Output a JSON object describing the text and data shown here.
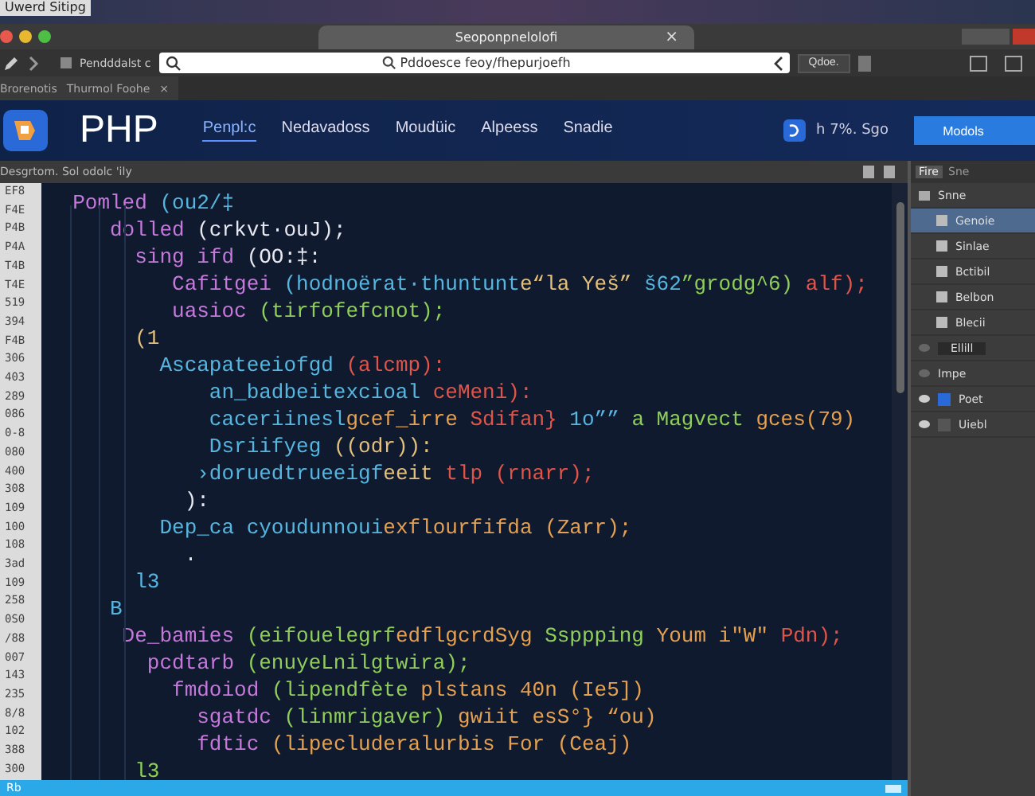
{
  "top_strip": {
    "label": "Uwerd Sitipg"
  },
  "window": {
    "tab_title": "Seoponpnelolofi",
    "close": "×"
  },
  "toolbar": {
    "label": "Pendddalst c",
    "address": "Pddoesce feoy/fhepurjoefh",
    "button": "Qdoe."
  },
  "bookmarks": {
    "items": [
      "Brorenotis",
      "Thurmol Foohe"
    ],
    "close": "×"
  },
  "site": {
    "logo": "PHP",
    "nav": [
      {
        "label": "Penpl:c",
        "selected": true
      },
      {
        "label": "Nedavadoss",
        "selected": false
      },
      {
        "label": "Moudüic",
        "selected": false
      },
      {
        "label": "Alpeess",
        "selected": false
      },
      {
        "label": "Snadie",
        "selected": false
      }
    ],
    "stat": "h 7%. Sgo",
    "button": "Modols"
  },
  "editor": {
    "title": "Desgrtom. Sol odolc 'ily",
    "gutter": [
      "EF8",
      "F4E",
      "P4B",
      "P4A",
      "T4B",
      "T4E",
      "519",
      "394",
      "F4B",
      "306",
      "403",
      "289",
      "086",
      "0-8",
      "080",
      "400",
      "308",
      "109",
      "100",
      "108",
      "3ad",
      "109",
      "258",
      "0S0",
      "/88",
      "007",
      "143",
      "235",
      "8/8",
      "102",
      "388",
      "300"
    ],
    "lines": [
      [
        {
          "text": "  Pomled ",
          "color": "#c678dd"
        },
        {
          "text": "(ou2/‡",
          "color": "#56b6e0"
        }
      ],
      [
        {
          "text": "     dolled ",
          "color": "#c678dd"
        },
        {
          "text": "(crkvt·ouJ);",
          "color": "#e8e8f0"
        }
      ],
      [
        {
          "text": "       sing ifd ",
          "color": "#c678dd"
        },
        {
          "text": "(OO:‡:",
          "color": "#e8e8f0"
        }
      ],
      [
        {
          "text": "          Cafitgei ",
          "color": "#c678dd"
        },
        {
          "text": "(hodnoërat·thuntunt",
          "color": "#56b6e0"
        },
        {
          "text": "e“la Yeš” ",
          "color": "#e5c07b"
        },
        {
          "text": "š62",
          "color": "#56b6e0"
        },
        {
          "text": "”grodg^6) ",
          "color": "#8fce5a"
        },
        {
          "text": "alf);",
          "color": "#e0554a"
        }
      ],
      [
        {
          "text": "          uasioc ",
          "color": "#c678dd"
        },
        {
          "text": "(tirfofefcnot);",
          "color": "#8fce5a"
        }
      ],
      [
        {
          "text": "       (1",
          "color": "#e5c07b"
        }
      ],
      [
        {
          "text": "         Ascapateeiofgd ",
          "color": "#56b6e0"
        },
        {
          "text": "(alcmp):",
          "color": "#e0554a"
        }
      ],
      [
        {
          "text": "             an_badbeitexcioal ",
          "color": "#56b6e0"
        },
        {
          "text": "ceMeni):",
          "color": "#e0554a"
        }
      ],
      [
        {
          "text": "             caceriinesl",
          "color": "#56b6e0"
        },
        {
          "text": "gcef_irre ",
          "color": "#e5a050"
        },
        {
          "text": "Sdifan} ",
          "color": "#e0554a"
        },
        {
          "text": "1o”” ",
          "color": "#56b6e0"
        },
        {
          "text": "a Magvect ",
          "color": "#8fce5a"
        },
        {
          "text": "gces(79)",
          "color": "#e5a050"
        }
      ],
      [
        {
          "text": "             Dsriifyeg ",
          "color": "#56b6e0"
        },
        {
          "text": "((odr)):",
          "color": "#e5c07b"
        }
      ],
      [
        {
          "text": "            ›doruedtrueeigf",
          "color": "#56b6e0"
        },
        {
          "text": "eeit ",
          "color": "#e5c07b"
        },
        {
          "text": "tlp (rnarr);",
          "color": "#e0554a"
        }
      ],
      [
        {
          "text": "           ):",
          "color": "#e8e8f0"
        }
      ],
      [
        {
          "text": "         Dep_ca ",
          "color": "#56b6e0"
        },
        {
          "text": "cyoudunnoui",
          "color": "#56b6e0"
        },
        {
          "text": "exflourfi",
          "color": "#e5a050"
        },
        {
          "text": "fda (Zarr);",
          "color": "#e5a050"
        }
      ],
      [
        {
          "text": "           .",
          "color": "#e8e8f0"
        }
      ],
      [
        {
          "text": "       l3",
          "color": "#56b6e0"
        }
      ],
      [
        {
          "text": "     B",
          "color": "#56b6e0"
        }
      ],
      [
        {
          "text": "      De_bamies ",
          "color": "#c678dd"
        },
        {
          "text": "(eifouelegrf",
          "color": "#8fce5a"
        },
        {
          "text": "edflgcrdSyg ",
          "color": "#e5a050"
        },
        {
          "text": "Ssppping ",
          "color": "#8fce5a"
        },
        {
          "text": "Youm i\"W\" ",
          "color": "#e5a050"
        },
        {
          "text": "Pdn);",
          "color": "#e0554a"
        }
      ],
      [
        {
          "text": "        pcdtarb ",
          "color": "#c678dd"
        },
        {
          "text": "(enuyeLnilgtwira);",
          "color": "#8fce5a"
        }
      ],
      [
        {
          "text": "          fmdoiod ",
          "color": "#c678dd"
        },
        {
          "text": "(lipendfète ",
          "color": "#8fce5a"
        },
        {
          "text": "plstans 40n (Ie5])",
          "color": "#e5a050"
        }
      ],
      [
        {
          "text": "            sgatdc ",
          "color": "#c678dd"
        },
        {
          "text": "(linmrigaver) ",
          "color": "#8fce5a"
        },
        {
          "text": "gwiit esS°} “ou)",
          "color": "#e5a050"
        }
      ],
      [
        {
          "text": "            fdtic ",
          "color": "#c678dd"
        },
        {
          "text": "(lipecluderalurbis ",
          "color": "#e5a050"
        },
        {
          "text": "For (Ceaj)",
          "color": "#e5a050"
        }
      ],
      [
        {
          "text": "       l3",
          "color": "#8fce5a"
        }
      ]
    ]
  },
  "panel": {
    "tabs": [
      {
        "label": "Fire",
        "selected": true
      },
      {
        "label": "Sne",
        "selected": false
      }
    ],
    "heading": "Snne",
    "items": [
      {
        "label": "Genoie",
        "selected": true
      },
      {
        "label": "Sinlae",
        "selected": false
      },
      {
        "label": "Bctibil",
        "selected": false
      },
      {
        "label": "Belbon",
        "selected": false
      },
      {
        "label": "Blecii",
        "selected": false
      }
    ],
    "field": "Ellill",
    "section": "Impe",
    "layers": [
      {
        "label": "Poet",
        "visible": true
      },
      {
        "label": "Uiebl",
        "visible": true
      }
    ]
  },
  "status": {
    "label": "Rb"
  }
}
